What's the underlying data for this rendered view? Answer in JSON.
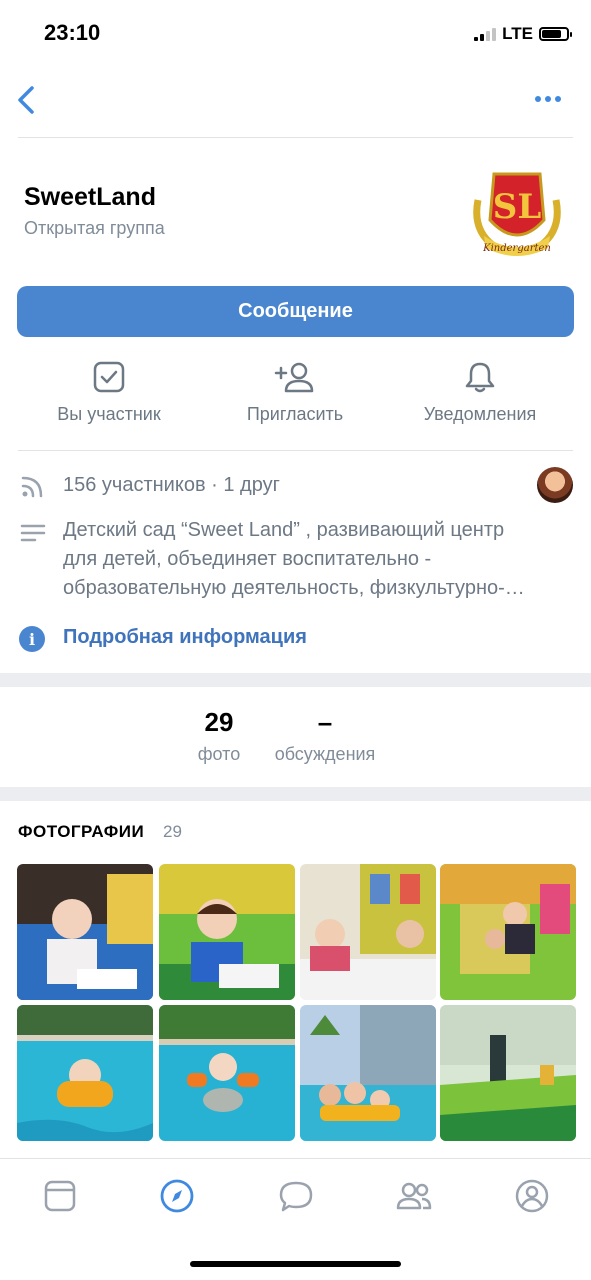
{
  "status_bar": {
    "time": "23:10",
    "network": "LTE"
  },
  "group": {
    "name": "SweetLand",
    "type": "Открытая группа",
    "logo_text": "Kindergarten",
    "logo_letters": "SL"
  },
  "actions": {
    "message": "Сообщение",
    "member": "Вы участник",
    "invite": "Пригласить",
    "notifications": "Уведомления"
  },
  "info": {
    "members": "156 участников · 1 друг",
    "description_lines": [
      "Детский сад “Sweet Land” , развивающий центр",
      "для детей, объединяет воспитательно -",
      "образовательную деятельность, физкультурно-…"
    ],
    "details_link": "Подробная информация"
  },
  "counters": [
    {
      "value": "29",
      "label": "фото"
    },
    {
      "value": "–",
      "label": "обсуждения"
    }
  ],
  "photos": {
    "title": "ФОТОГРАФИИ",
    "count": "29"
  },
  "tabbar": [
    "feed-icon",
    "discover-icon",
    "messages-icon",
    "friends-icon",
    "profile-icon"
  ],
  "colors": {
    "accent": "#4a86cf",
    "link": "#3f74bc",
    "secondary_text": "#6d7885"
  }
}
